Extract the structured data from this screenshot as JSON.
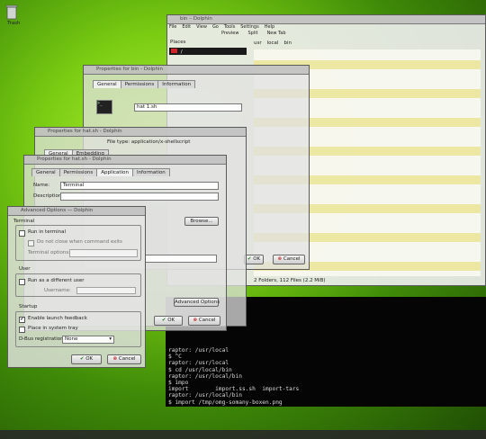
{
  "desktop": {
    "trash_label": "Trash"
  },
  "dolphin": {
    "title": "bin – Dolphin",
    "menu": [
      "File",
      "Edit",
      "View",
      "Go",
      "Tools",
      "Settings",
      "Help"
    ],
    "toolbar": [
      "Preview",
      "Split",
      "New Tab"
    ],
    "places_label": "Places",
    "places_item": "/",
    "breadcrumb": [
      "usr",
      "local",
      "bin"
    ],
    "status": "2 Folders, 112 Files (2.2 MiB)"
  },
  "props_back": {
    "title": "Properties for bin - Dolphin",
    "tabs": [
      "General",
      "Permissions",
      "Information"
    ],
    "filename": "hat 1.sh",
    "ok_label": "OK",
    "cancel_label": "Cancel"
  },
  "props_middle": {
    "title": "Properties for hat.sh - Dolphin",
    "tabs": [
      "General",
      "Embedding"
    ],
    "filetype_text": "File type: application/x-shellscript"
  },
  "props_front": {
    "title": "Properties for hat.sh - Dolphin",
    "tabs": [
      "General",
      "Permissions",
      "Application",
      "Information"
    ],
    "name_label": "Name:",
    "name_value": "Terminal",
    "desc_label": "Description:",
    "browse_label": "Browse...",
    "advanced_label": "Advanced Options",
    "ok_label": "OK",
    "cancel_label": "Cancel"
  },
  "advanced": {
    "title": "Advanced Options — Dolphin",
    "terminal_group": "Terminal",
    "run_in_terminal": "Run in terminal",
    "dont_close": "Do not close when command exits",
    "terminal_options": "Terminal options:",
    "user_group": "User",
    "run_as_user": "Run as a different user",
    "username_label": "Username:",
    "startup_group": "Startup",
    "launch_feedback": "Enable launch feedback",
    "system_tray": "Place in system tray",
    "dbus_label": "D-Bus registration:",
    "dbus_value": "None",
    "ok_label": "OK",
    "cancel_label": "Cancel"
  },
  "terminal": {
    "lines": [
      "raptor: /usr/local",
      "$ ^C",
      "raptor: /usr/local",
      "$ cd /usr/local/bin",
      "raptor: /usr/local/bin",
      "$ impo",
      "import        import.ss.sh  import-tars",
      "raptor: /usr/local/bin",
      "$ import /tmp/omg-somany-boxen.png"
    ]
  },
  "colors": {
    "terminal_bg": "#050505",
    "file_row_yellow": "#ece7a3",
    "desktop_green": "#79cc12"
  }
}
